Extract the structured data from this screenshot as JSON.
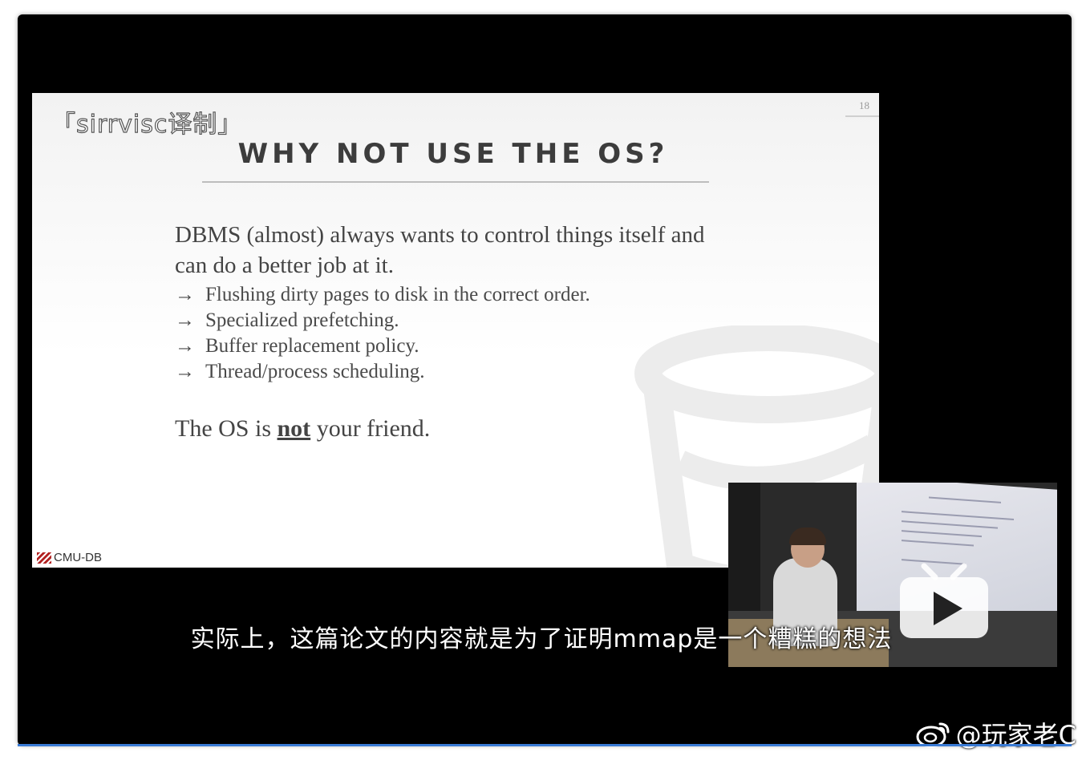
{
  "slide": {
    "page_number": "18",
    "top_watermark": "「sirrvisc译制」",
    "title": "WHY NOT USE THE OS?",
    "lead": "DBMS (almost) always wants to control things itself and can do a better job at it.",
    "bullet_marker": "→",
    "bullets": [
      "Flushing dirty pages to disk in the correct order.",
      "Specialized prefetching.",
      "Buffer replacement policy.",
      "Thread/process scheduling."
    ],
    "closing_pre": "The OS is ",
    "closing_emph": "not",
    "closing_post": " your friend.",
    "logo_text": "CMU-DB"
  },
  "video": {
    "subtitle": "实际上，这篇论文的内容就是为了证明mmap是一个糟糕的想法",
    "play_icon": "bilibili-play-icon"
  },
  "weibo": {
    "icon": "weibo-icon",
    "handle": "@玩家老C"
  },
  "colors": {
    "frame_bg": "#000000",
    "slide_bg": "#ffffff",
    "title_text": "#3c3c3c",
    "accent_line": "#3a7bd5"
  }
}
